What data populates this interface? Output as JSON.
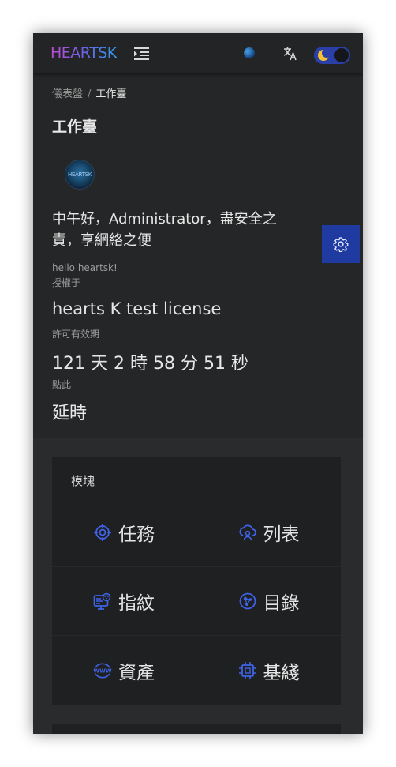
{
  "header": {
    "logo_text": "HEARTSK",
    "menu_icon": "menu-fold-icon",
    "globe_icon": "globe-icon",
    "translate_icon": "translate-icon",
    "theme_toggle_icon": "moon-icon"
  },
  "breadcrumb": {
    "items": [
      "儀表盤",
      "工作臺"
    ],
    "separator": "/"
  },
  "page_title": "工作臺",
  "profile": {
    "avatar_text": "HEARTSK",
    "greeting": "中午好，Administrator，盡安全之責，享網絡之便",
    "hello": "hello heartsk!",
    "granted_label": "授權于",
    "license_name": "hearts K test license",
    "validity_label": "許可有效期",
    "countdown": "121 天 2 時 58 分 51 秒",
    "click_label": "點此",
    "extend_link": "延時"
  },
  "settings_icon": "gear-icon",
  "modules": {
    "title": "模塊",
    "items": [
      {
        "label": "任務",
        "icon": "target-icon"
      },
      {
        "label": "列表",
        "icon": "cloud-user-icon"
      },
      {
        "label": "指紋",
        "icon": "fingerprint-screen-icon"
      },
      {
        "label": "目錄",
        "icon": "globe-network-icon"
      },
      {
        "label": "資產",
        "icon": "www-icon"
      },
      {
        "label": "基綫",
        "icon": "chip-icon"
      }
    ]
  },
  "colors": {
    "accent": "#2f4bd6",
    "panel": "#252627",
    "background": "#2a2b2c",
    "card": "#1f2021"
  }
}
